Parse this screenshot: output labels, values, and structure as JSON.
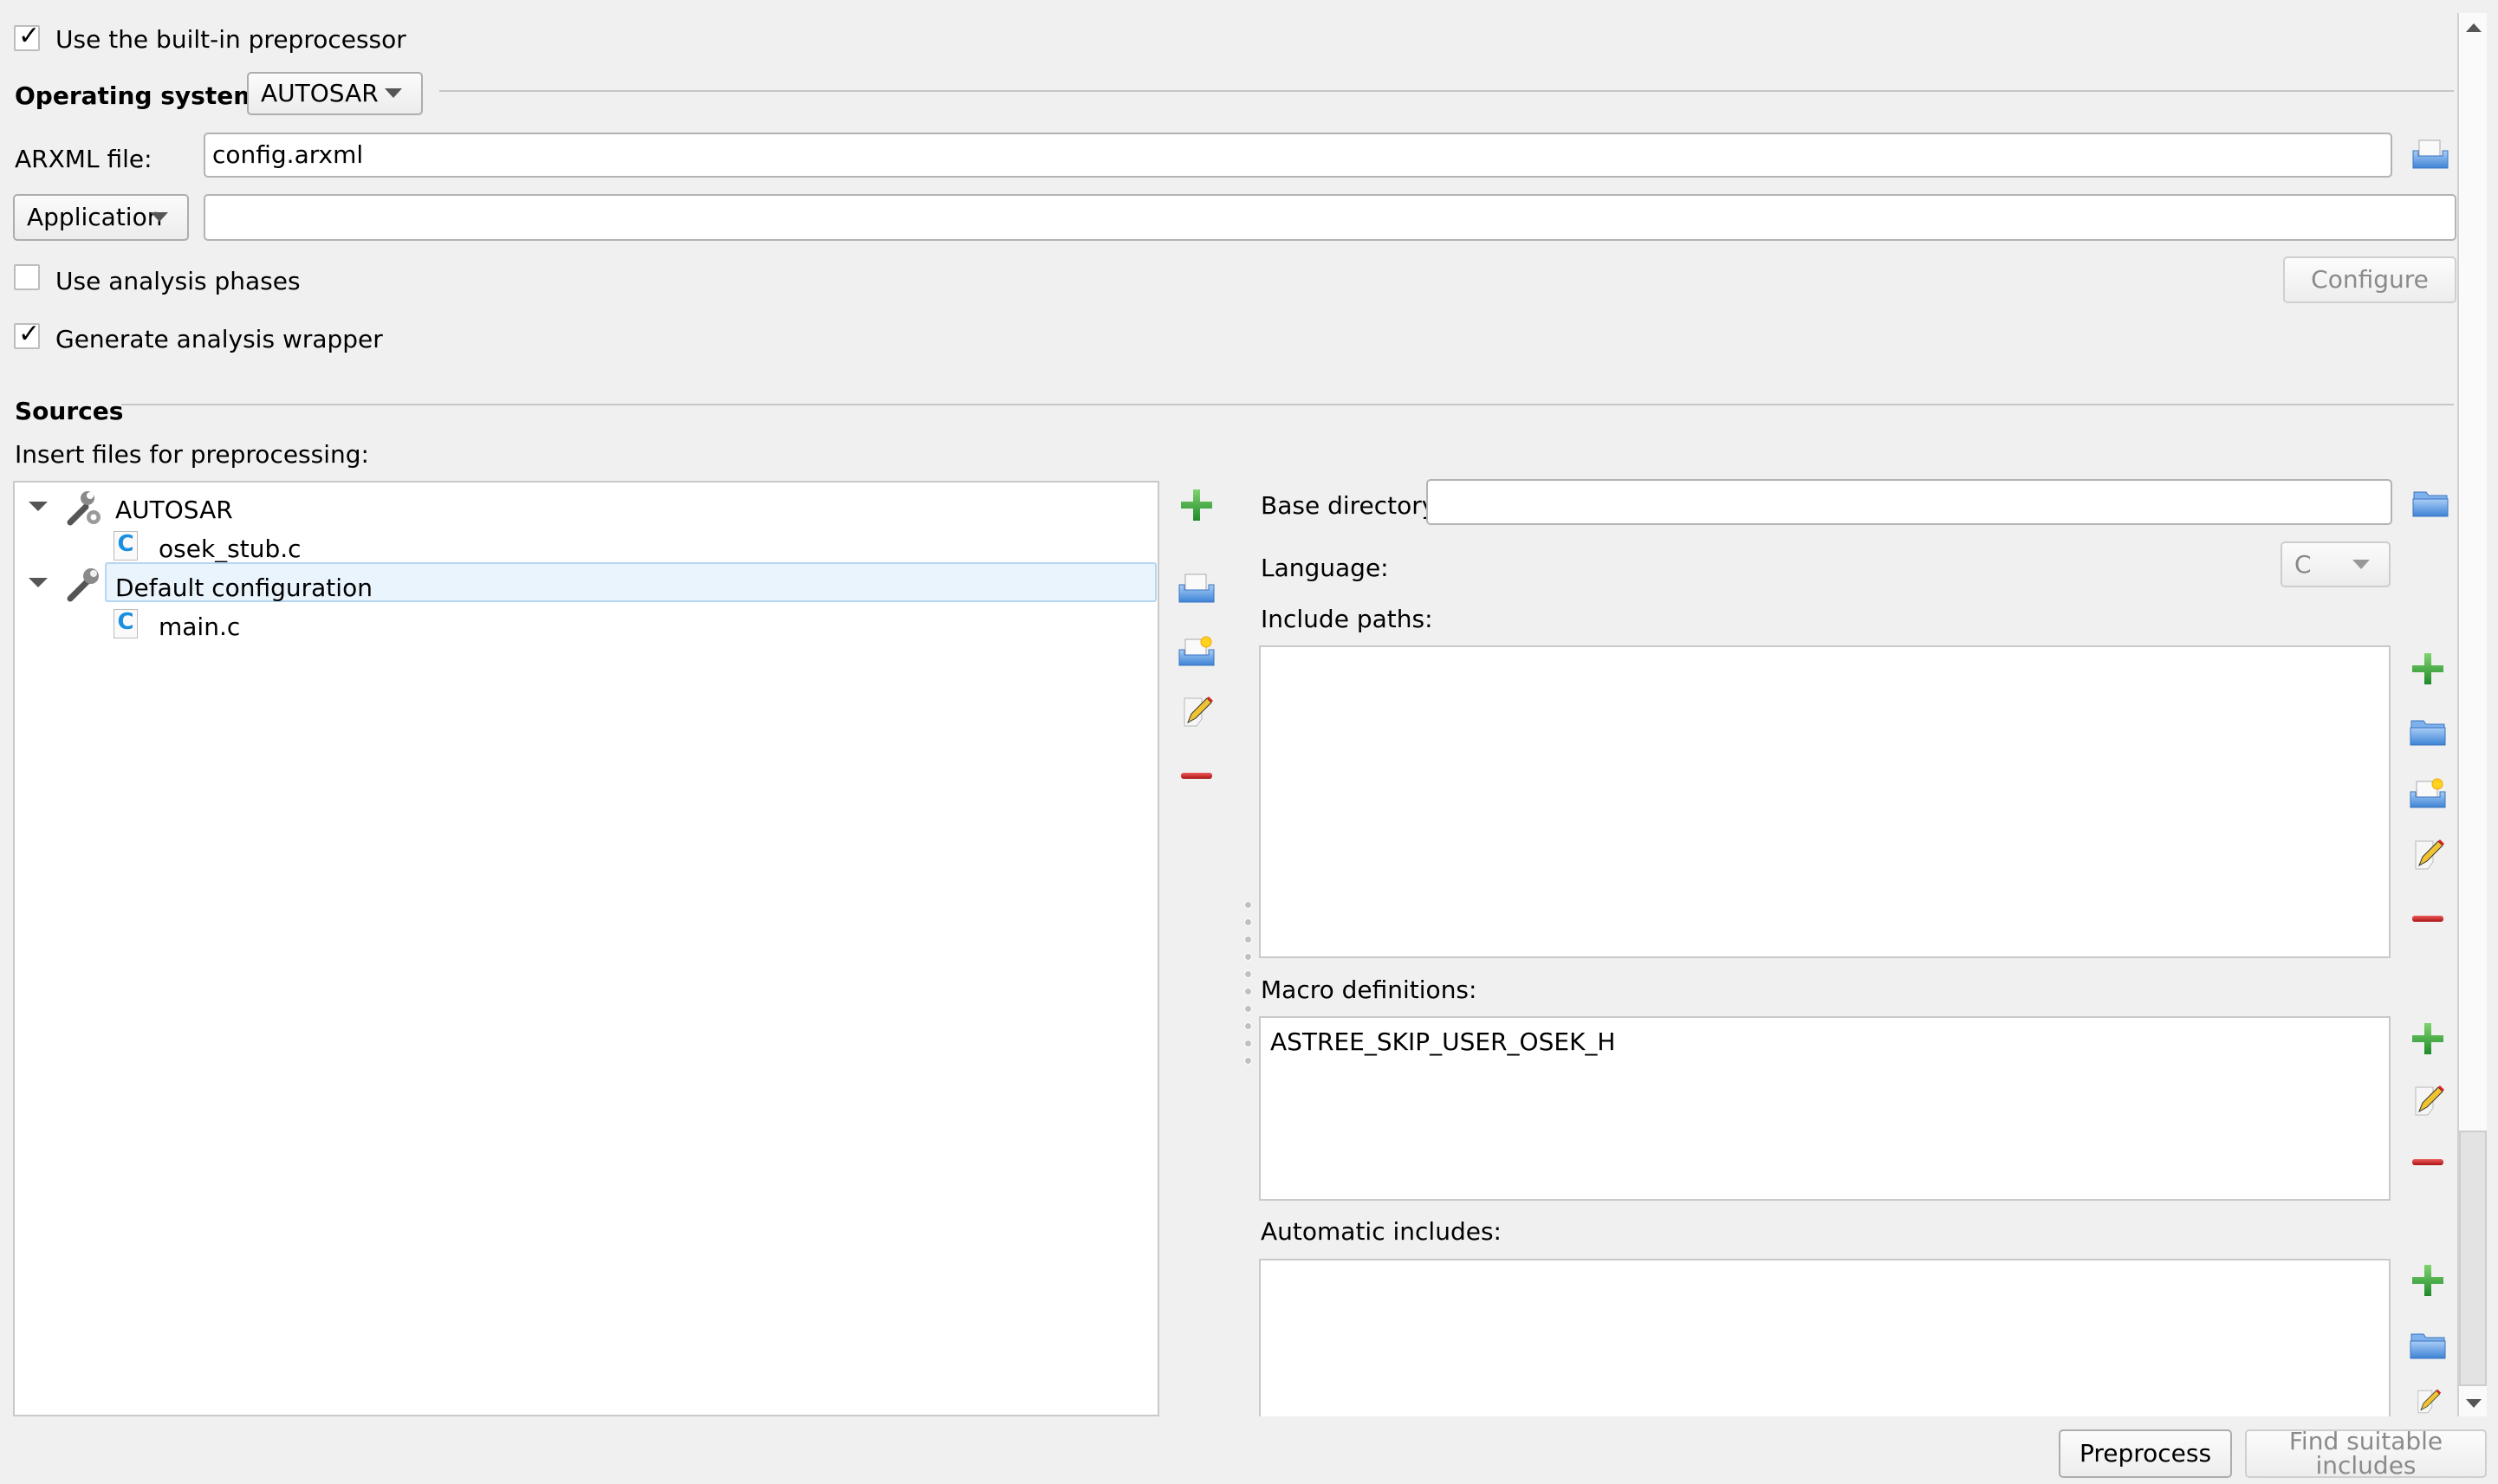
{
  "preprocessor": {
    "use_builtin_label": "Use the built-in preprocessor",
    "use_builtin_checked": true
  },
  "os": {
    "label": "Operating system:",
    "selected": "AUTOSAR"
  },
  "arxml": {
    "label": "ARXML file:",
    "value": "config.arxml",
    "browse_icon": "open-file-icon"
  },
  "application": {
    "selected": "Application",
    "value": ""
  },
  "analysis_phases": {
    "label": "Use analysis phases",
    "checked": false,
    "configure_label": "Configure"
  },
  "wrapper": {
    "label": "Generate analysis wrapper",
    "checked": true
  },
  "sources": {
    "heading": "Sources",
    "insert_label": "Insert files for preprocessing:",
    "tree": [
      {
        "label": "AUTOSAR",
        "icon": "wrench-gear-icon",
        "expanded": true,
        "children": [
          {
            "label": "osek_stub.c",
            "icon": "c-file-icon"
          }
        ]
      },
      {
        "label": "Default configuration",
        "icon": "wrench-icon",
        "expanded": true,
        "selected": true,
        "children": [
          {
            "label": "main.c",
            "icon": "c-file-icon"
          }
        ]
      }
    ],
    "tree_actions": [
      "add-icon",
      "open-file-icon",
      "new-file-icon",
      "edit-icon",
      "remove-icon"
    ]
  },
  "config": {
    "base_dir_label": "Base directory:",
    "base_dir_value": "",
    "language_label": "Language:",
    "language_selected": "C",
    "include_paths_label": "Include paths:",
    "include_paths": [],
    "include_actions": [
      "add-icon",
      "folder-icon",
      "new-file-icon",
      "edit-icon",
      "remove-icon"
    ],
    "macro_label": "Macro definitions:",
    "macros": [
      "ASTREE_SKIP_USER_OSEK_H"
    ],
    "macro_actions": [
      "add-icon",
      "edit-icon",
      "remove-icon"
    ],
    "auto_includes_label": "Automatic includes:",
    "auto_includes": [],
    "auto_include_actions": [
      "add-icon",
      "folder-icon",
      "edit-icon"
    ]
  },
  "footer": {
    "preprocess_label": "Preprocess",
    "find_includes_label": "Find suitable includes"
  },
  "colors": {
    "background": "#f0f0f0",
    "selection": "#eaf4fc",
    "c_icon": "#1a8fe0",
    "add_green": "#3aa53a",
    "remove_red": "#cc2222",
    "folder_blue": "#5e9be0"
  }
}
